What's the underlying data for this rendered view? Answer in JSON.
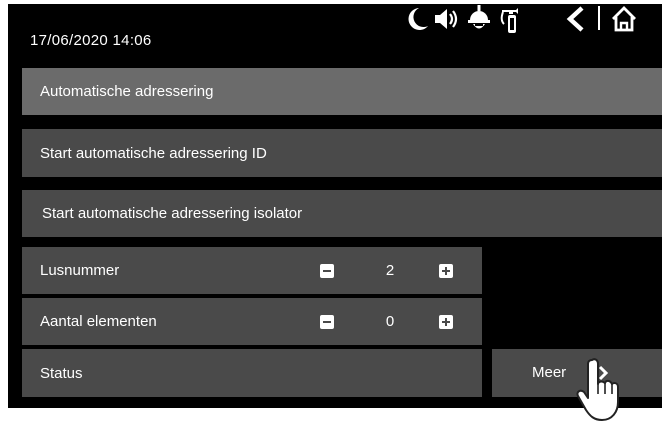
{
  "status_bar": {
    "datetime": "17/06/2020  14:06",
    "icons": [
      "moon-icon",
      "speaker-icon",
      "helmet-icon",
      "fire-extinguisher-icon",
      "back-icon",
      "home-icon"
    ]
  },
  "menu": {
    "header": "Automatische adressering",
    "items": [
      {
        "label": "Start automatische adressering ID"
      },
      {
        "label": "Start automatische adressering isolator"
      }
    ]
  },
  "settings": {
    "loop": {
      "label": "Lusnummer",
      "value": "2"
    },
    "elements": {
      "label": "Aantal elementen",
      "value": "0"
    },
    "status": {
      "label": "Status",
      "value": ""
    }
  },
  "more_button": {
    "label": "Meer"
  },
  "colors": {
    "background": "#000000",
    "row": "#4a4a4a",
    "header_row": "#6b6b6b",
    "text": "#ffffff"
  }
}
